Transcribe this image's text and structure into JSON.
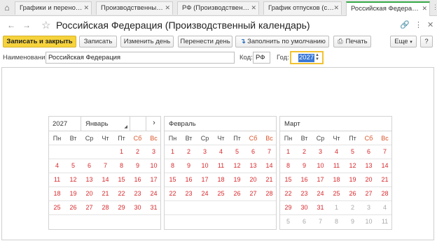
{
  "tabs": [
    {
      "label": "Графики и переносы о...",
      "active": false
    },
    {
      "label": "Производственные ка...",
      "active": false
    },
    {
      "label": "РФ (Производственны...",
      "active": false
    },
    {
      "label": "График отпусков (созд...",
      "active": false
    },
    {
      "label": "Российская Федерация...",
      "active": true
    }
  ],
  "header": {
    "title": "Российская Федерация (Производственный календарь)"
  },
  "toolbar": {
    "save_close": "Записать и закрыть",
    "save": "Записать",
    "change_day": "Изменить день",
    "move_day": "Перенести день",
    "fill_default": "Заполнить по умолчанию",
    "print": "Печать",
    "more": "Еще",
    "help": "?"
  },
  "fields": {
    "name_label": "Наименование:",
    "name_value": "Российская Федерация",
    "code_label": "Код:",
    "code_value": "РФ",
    "year_label": "Год:",
    "year_value": "2027"
  },
  "calendar": {
    "year": "2027",
    "dow": [
      "Пн",
      "Вт",
      "Ср",
      "Чт",
      "Пт",
      "Сб",
      "Вс"
    ],
    "months": [
      {
        "name": "Январь",
        "prev_days": [],
        "days": 31,
        "next_days": []
      },
      {
        "name": "Февраль",
        "prev_days": [],
        "days": 28,
        "next_days": []
      },
      {
        "name": "Март",
        "prev_days": [],
        "days": 31,
        "next_days": [
          1,
          2,
          3,
          4,
          5,
          6,
          7,
          8,
          9,
          10,
          11
        ]
      }
    ],
    "colors": {
      "holiday": "#d8272b",
      "weekend_header": "#d9552b",
      "other_month": "#a9a9a9"
    }
  }
}
